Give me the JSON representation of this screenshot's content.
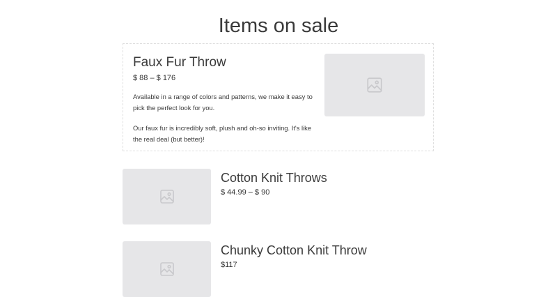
{
  "page": {
    "title": "Items on sale"
  },
  "featured": {
    "name": "Faux Fur Throw",
    "price": "$ 88 – $ 176",
    "description": [
      "Available in a range of colors and patterns, we make it easy to pick the perfect look for you.",
      "Our faux fur is incredibly soft, plush and oh-so inviting. It's like the real deal (but better)!"
    ],
    "image_icon": "image-placeholder-icon"
  },
  "items": [
    {
      "name": "Cotton Knit Throws",
      "price": "$ 44.99 – $ 90",
      "image_icon": "image-placeholder-icon"
    },
    {
      "name": "Chunky Cotton Knit Throw",
      "price": "$117",
      "image_icon": "image-placeholder-icon"
    }
  ],
  "colors": {
    "placeholder_bg": "#e6e6e8",
    "placeholder_icon": "#c9c9cc",
    "text": "#333333",
    "card_border": "#dedede"
  }
}
